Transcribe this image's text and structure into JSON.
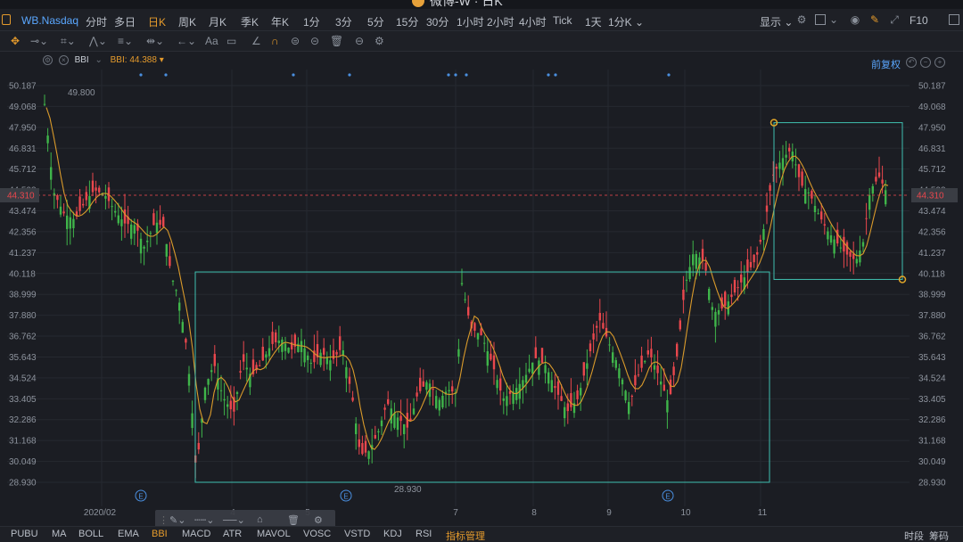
{
  "window": {
    "title": "微博-W · 日K"
  },
  "period_bar": {
    "symbol": "WB.Nasdaq",
    "periods": [
      {
        "label": "分时",
        "active": false
      },
      {
        "label": "多日",
        "active": false
      },
      {
        "label": "日K",
        "active": true
      },
      {
        "label": "周K",
        "active": false
      },
      {
        "label": "月K",
        "active": false
      },
      {
        "label": "季K",
        "active": false
      },
      {
        "label": "年K",
        "active": false
      },
      {
        "label": "1分",
        "active": false
      },
      {
        "label": "3分",
        "active": false
      },
      {
        "label": "5分",
        "active": false
      },
      {
        "label": "15分",
        "active": false
      },
      {
        "label": "30分",
        "active": false
      },
      {
        "label": "1小时",
        "active": false
      },
      {
        "label": "2小时",
        "active": false
      },
      {
        "label": "4小时",
        "active": false
      },
      {
        "label": "Tick",
        "active": false
      },
      {
        "label": "1天",
        "active": false
      },
      {
        "label": "1分K",
        "active": false
      }
    ],
    "display_label": "显示",
    "f10_label": "F10"
  },
  "indicator_header": {
    "name": "BBI",
    "value_text": "BBI: 44.388",
    "restore_label": "前复权"
  },
  "chart_data": {
    "type": "candlestick",
    "title": "",
    "y_ticks": [
      50.187,
      49.068,
      47.95,
      46.831,
      45.712,
      44.593,
      43.474,
      42.356,
      41.237,
      40.118,
      38.999,
      37.88,
      36.762,
      35.643,
      34.524,
      33.405,
      32.286,
      31.168,
      30.049,
      28.93
    ],
    "ylim": [
      28.93,
      50.187
    ],
    "current_price": 44.31,
    "x_labels": [
      "2020/02",
      "4",
      "5",
      "7",
      "8",
      "9",
      "10",
      "11"
    ],
    "high_annotation": 49.8,
    "low_annotation": 28.93,
    "event_markers": [
      "E",
      "E",
      "E"
    ],
    "colors": {
      "up": "#3fb54a",
      "down": "#e9474d",
      "bbi": "#d99a2b",
      "box": "#3fc0b0",
      "price_line": "#e9474d"
    }
  },
  "float_tool": {
    "icons": [
      "pen-icon",
      "line-style-icon",
      "line-width-icon",
      "lock-icon",
      "trash-icon",
      "settings-icon"
    ]
  },
  "indicator_tabs": {
    "items": [
      {
        "label": "PUBU",
        "active": false
      },
      {
        "label": "MA",
        "active": false
      },
      {
        "label": "BOLL",
        "active": false
      },
      {
        "label": "EMA",
        "active": false
      },
      {
        "label": "BBI",
        "active": true
      },
      {
        "label": "MACD",
        "active": false
      },
      {
        "label": "ATR",
        "active": false
      },
      {
        "label": "MAVOL",
        "active": false
      },
      {
        "label": "VOSC",
        "active": false
      },
      {
        "label": "VSTD",
        "active": false
      },
      {
        "label": "KDJ",
        "active": false
      },
      {
        "label": "RSI",
        "active": false
      },
      {
        "label": "指标管理",
        "active": true
      }
    ],
    "right_labels": [
      "时段",
      "筹码"
    ]
  }
}
